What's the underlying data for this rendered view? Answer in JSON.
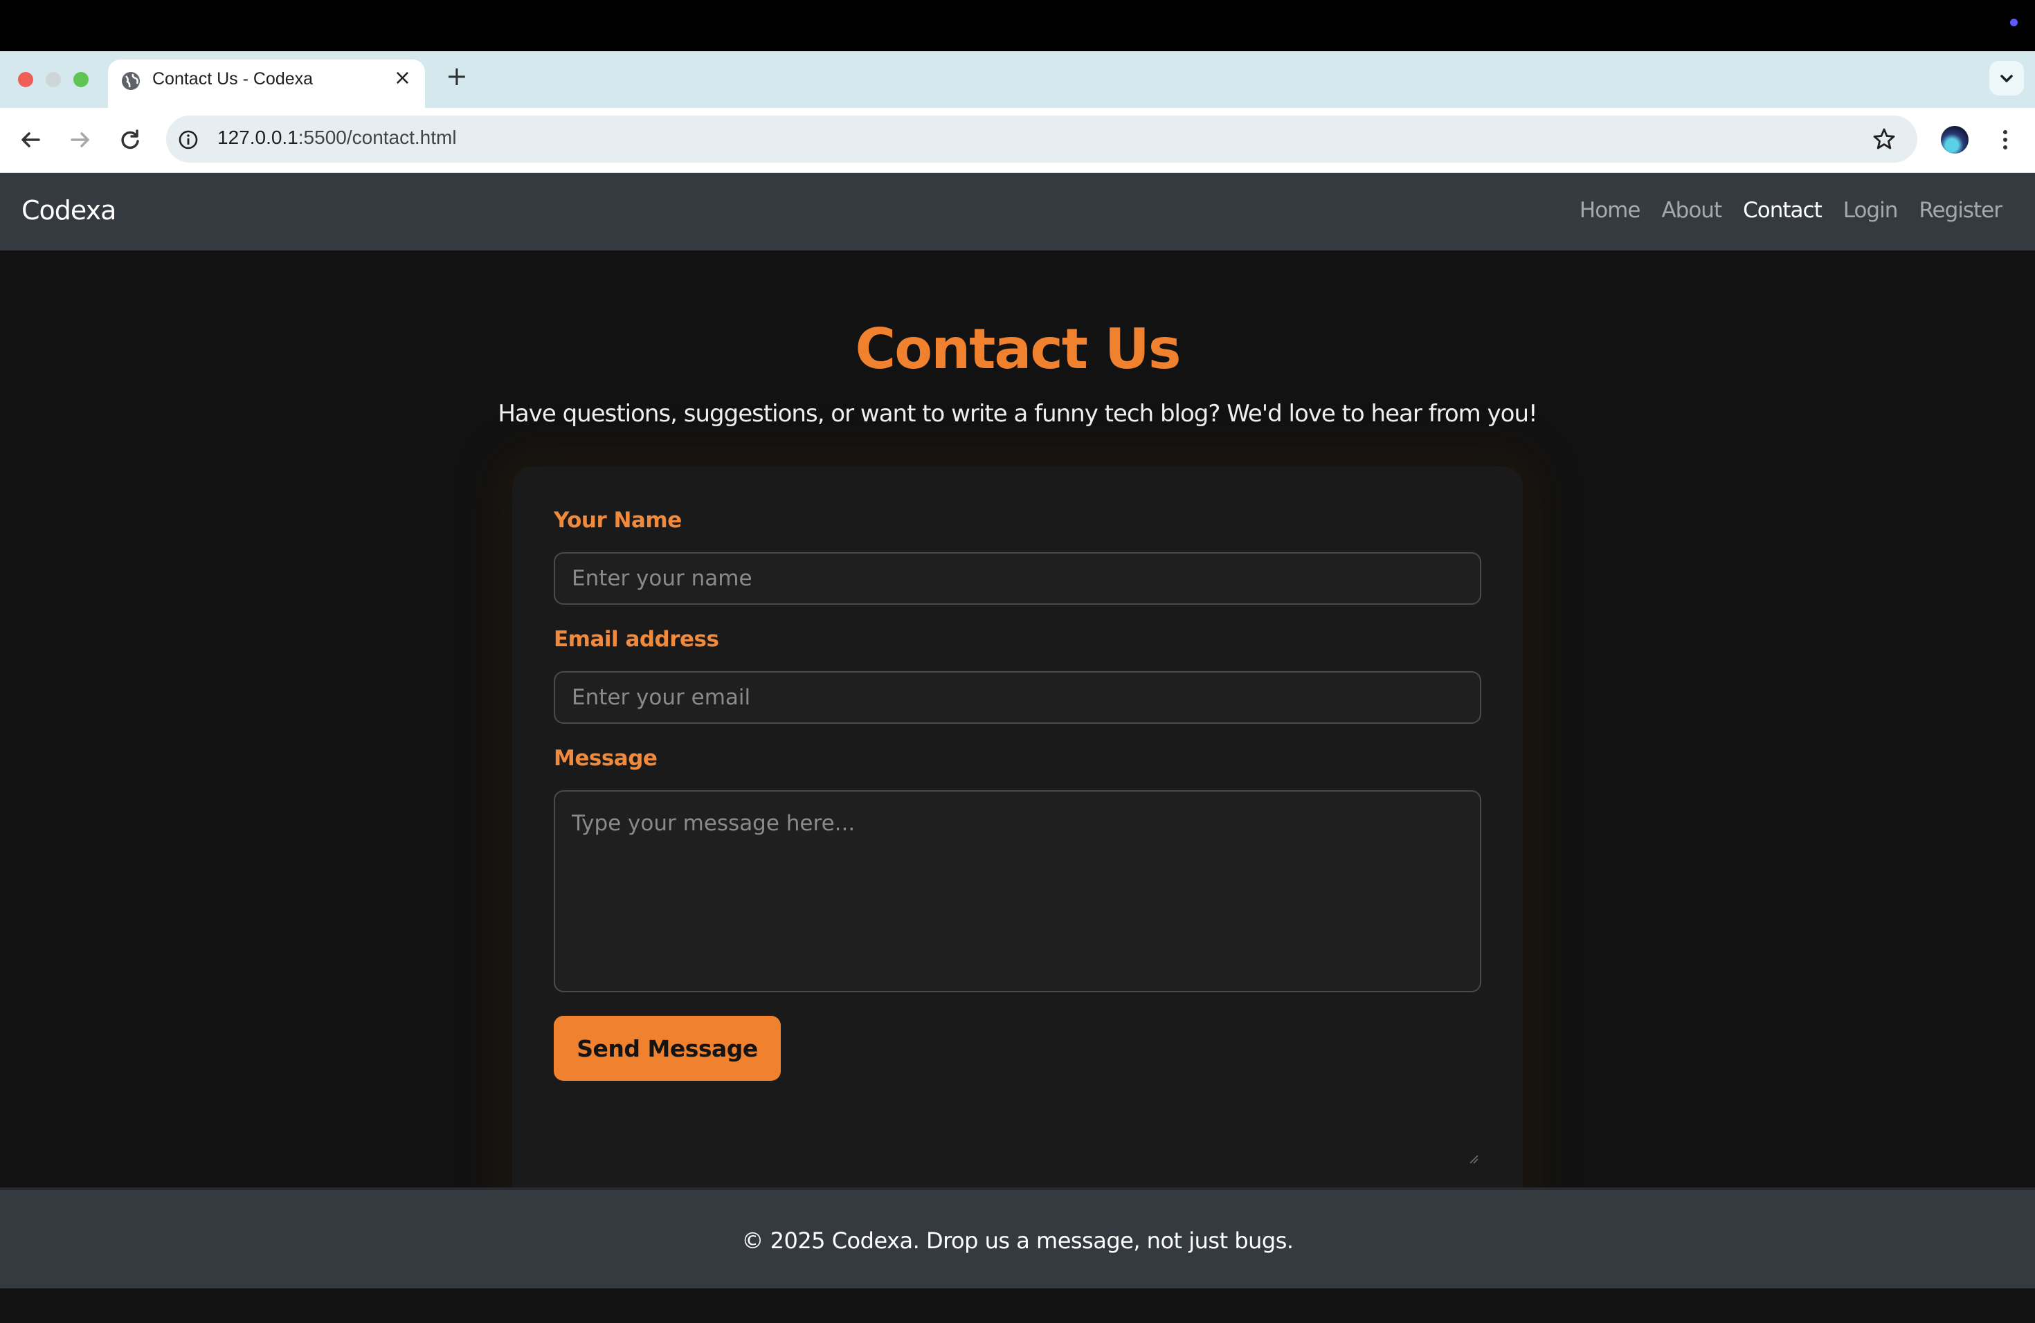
{
  "browser": {
    "tab_title": "Contact Us - Codexa",
    "url_host": "127.0.0.1",
    "url_path": ":5500/contact.html"
  },
  "site": {
    "brand": "Codexa",
    "nav": {
      "home": "Home",
      "about": "About",
      "contact": "Contact",
      "login": "Login",
      "register": "Register"
    },
    "active_nav": "Contact"
  },
  "contact": {
    "heading": "Contact Us",
    "subheading": "Have questions, suggestions, or want to write a funny tech blog? We'd love to hear from you!",
    "name_label": "Your Name",
    "name_placeholder": "Enter your name",
    "name_value": "",
    "email_label": "Email address",
    "email_placeholder": "Enter your email",
    "email_value": "",
    "message_label": "Message",
    "message_placeholder": "Type your message here...",
    "message_value": "",
    "submit_label": "Send Message"
  },
  "footer": {
    "text": "© 2025 Codexa. Drop us a message, not just bugs."
  },
  "colors": {
    "accent": "#f0822f",
    "navbar": "#343a40",
    "background": "#121212"
  }
}
